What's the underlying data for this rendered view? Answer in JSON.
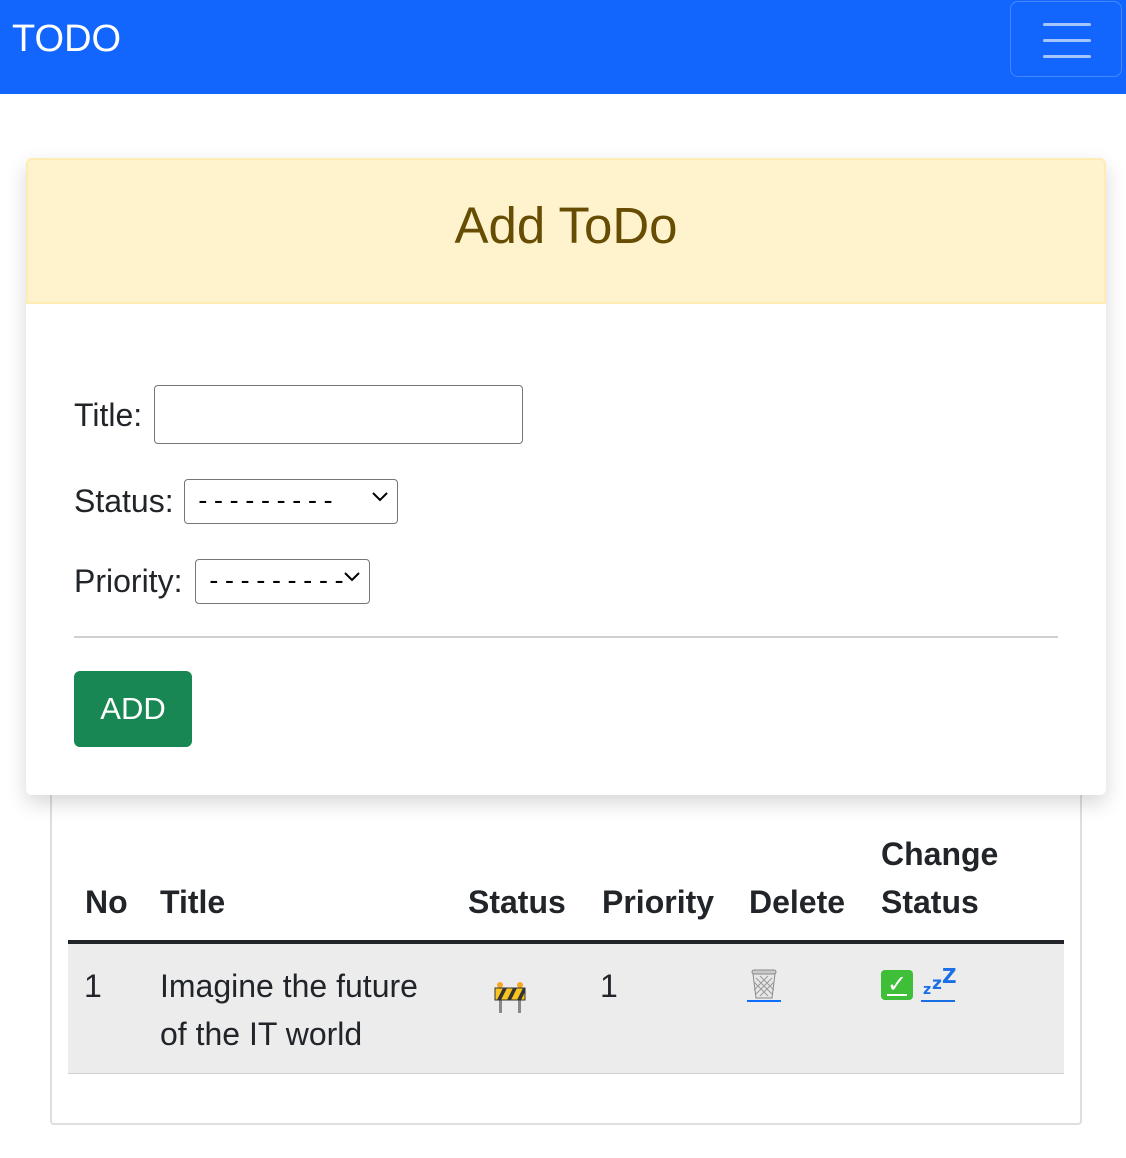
{
  "navbar": {
    "brand": "TODO",
    "bg_color": "#1266fd",
    "menu_icon": "hamburger-menu-icon"
  },
  "form": {
    "header": "Add ToDo",
    "header_bg": "#fff3cd",
    "title_label": "Title:",
    "title_value": "",
    "status_label": "Status:",
    "status_selected": "---------",
    "priority_label": "Priority:",
    "priority_selected": "---------",
    "add_label": "ADD",
    "add_color": "#198754"
  },
  "table": {
    "headers": {
      "no": "No",
      "title": "Title",
      "status": "Status",
      "priority": "Priority",
      "delete": "Delete",
      "change_status_line1": "Change",
      "change_status_line2": "Status"
    },
    "rows": [
      {
        "no": "1",
        "title_line1": "Imagine the future",
        "title_line2": "of the IT world",
        "status_icon": "construction-barrier-icon",
        "priority": "1",
        "delete_icon": "wastebasket-icon",
        "done_icon": "check-mark-button-icon",
        "sleep_icon": "zzz-icon"
      }
    ]
  }
}
